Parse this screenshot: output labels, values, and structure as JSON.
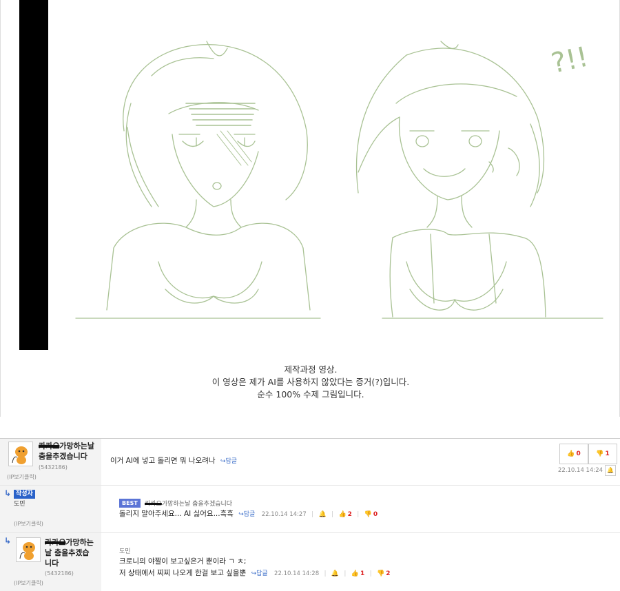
{
  "post": {
    "caption": [
      "제작과정 영상.",
      "이 영상은 제가 AI를 사용하지 않았다는 증거(?)입니다.",
      "순수 100% 수제 그림입니다."
    ],
    "sketch_text": "?!!"
  },
  "comments": [
    {
      "nick_strike": "카카오",
      "nick_line1": "가망하는날",
      "nick_line2": "춤을추겠습니다",
      "uid": "(5432186)",
      "ip": "(IP보기클릭)",
      "body": "이거 AI에 넣고 돌리면 뭐 나오려나",
      "reply_label": "답글",
      "up": "0",
      "down": "1",
      "date": "22.10.14 14:24"
    },
    {
      "writer_badge": "작성자",
      "writer_name": "도민",
      "ip": "(IP보기클릭)",
      "best_label": "BEST",
      "quoted_nick": "가망하는날 춤을추겠습니다",
      "body": "돌리지 말아주세요... AI 싫어요...흑흑",
      "reply_label": "답글",
      "date": "22.10.14 14:27",
      "up": "2",
      "down": "0"
    },
    {
      "nick_strike": "카카오",
      "nick_line1": "가망하는",
      "nick_line2": "날 춤을추겠습",
      "nick_line3": "니다",
      "uid": "(5432186)",
      "ip": "(IP보기클릭)",
      "quoted_nick": "도민",
      "body_line1": "크로니의 야짤이 보고싶은거 뿐이라 ㄱ ㅊ;",
      "body_line2": "저 상태에서 찌찌 나오게 한걸 보고 싶을뿐",
      "reply_label": "답글",
      "date": "22.10.14 14:28",
      "up": "1",
      "down": "2"
    }
  ],
  "colors": {
    "sketch": "#a9c294",
    "accent": "#3a6cc8",
    "down": "#dd2222"
  }
}
